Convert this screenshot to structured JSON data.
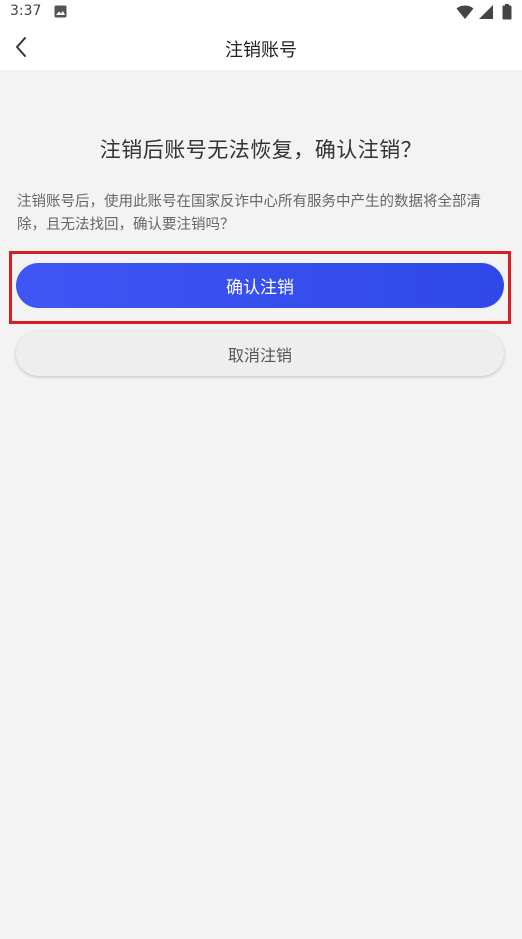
{
  "status_bar": {
    "time": "3:37",
    "icons": [
      "image-icon",
      "wifi-icon",
      "signal-icon",
      "battery-icon"
    ]
  },
  "app_bar": {
    "title": "注销账号",
    "back_icon": "chevron-left-icon"
  },
  "main": {
    "heading": "注销后账号无法恢复，确认注销？",
    "description": "注销账号后，使用此账号在国家反诈中心所有服务中产生的数据将全部清除，且无法找回，确认要注销吗？",
    "confirm_label": "确认注销",
    "cancel_label": "取消注销"
  },
  "colors": {
    "primary": "#3a50f0",
    "highlight": "#d91f26",
    "background": "#f3f3f4"
  }
}
